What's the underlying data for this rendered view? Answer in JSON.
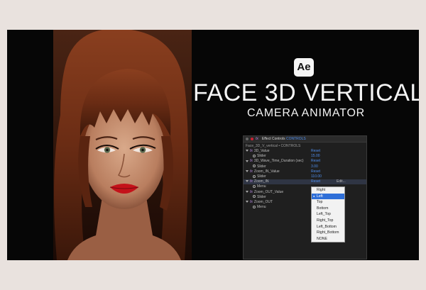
{
  "brand": {
    "logo_text": "Ae"
  },
  "title": "FACE 3D VERTICAL",
  "subtitle": "CAMERA ANIMATOR",
  "panel": {
    "header": "Effect Controls",
    "header_highlight": "CONTROLS",
    "subheader": "Face_3D_V_vertical • CONTROLS",
    "edit_label": "Edit...",
    "rows": [
      {
        "kind": "fx",
        "label": "3D_Value",
        "right": "Reset"
      },
      {
        "kind": "sub",
        "label": "Slider",
        "right": "15.00"
      },
      {
        "kind": "fx",
        "label": "3D_Wave_Time_Duration (sec)",
        "right": "Reset"
      },
      {
        "kind": "sub",
        "label": "Slider",
        "right": "3.00"
      },
      {
        "kind": "fx",
        "label": "Zoom_IN_Value",
        "right": "Reset"
      },
      {
        "kind": "sub",
        "label": "Slider",
        "right": "110.00"
      },
      {
        "kind": "fx",
        "label": "Zoom_IN",
        "right": "Reset",
        "highlight": true
      },
      {
        "kind": "sub",
        "label": "Menu",
        "right": ""
      },
      {
        "kind": "fx",
        "label": "Zoom_OUT_Value",
        "right": "Reset"
      },
      {
        "kind": "sub",
        "label": "Slider",
        "right": ""
      },
      {
        "kind": "fx",
        "label": "Zoom_OUT",
        "right": ""
      },
      {
        "kind": "sub",
        "label": "Menu",
        "right": ""
      }
    ]
  },
  "dropdown": {
    "selected": "Left",
    "options": [
      "Right",
      "Left",
      "Top",
      "Bottom",
      "Left_Top",
      "Right_Top",
      "Left_Bottom",
      "Right_Bottom",
      "NONE"
    ]
  },
  "colors": {
    "background": "#e9e2de",
    "card": "#060606",
    "accent": "#4f8ff0",
    "highlight": "#2f6fd8"
  }
}
